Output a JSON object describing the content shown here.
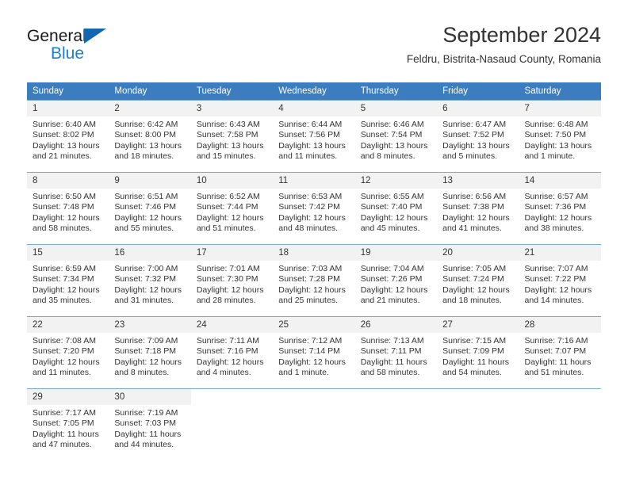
{
  "brand": {
    "word_one": "General",
    "word_two": "Blue",
    "triangle_color": "#1566b0",
    "blue_text_color": "#1a7fd4"
  },
  "header": {
    "month_title": "September 2024",
    "location": "Feldru, Bistrita-Nasaud County, Romania",
    "header_bg_color": "#3b7dbf",
    "header_text_color": "#ffffff",
    "daynum_bg_color": "#f2f2f2",
    "row_border_color": "#7aa9d4"
  },
  "calendar": {
    "weekday_headers": [
      "Sunday",
      "Monday",
      "Tuesday",
      "Wednesday",
      "Thursday",
      "Friday",
      "Saturday"
    ],
    "weeks": [
      [
        {
          "day": "1",
          "sunrise": "Sunrise: 6:40 AM",
          "sunset": "Sunset: 8:02 PM",
          "daylight": "Daylight: 13 hours and 21 minutes."
        },
        {
          "day": "2",
          "sunrise": "Sunrise: 6:42 AM",
          "sunset": "Sunset: 8:00 PM",
          "daylight": "Daylight: 13 hours and 18 minutes."
        },
        {
          "day": "3",
          "sunrise": "Sunrise: 6:43 AM",
          "sunset": "Sunset: 7:58 PM",
          "daylight": "Daylight: 13 hours and 15 minutes."
        },
        {
          "day": "4",
          "sunrise": "Sunrise: 6:44 AM",
          "sunset": "Sunset: 7:56 PM",
          "daylight": "Daylight: 13 hours and 11 minutes."
        },
        {
          "day": "5",
          "sunrise": "Sunrise: 6:46 AM",
          "sunset": "Sunset: 7:54 PM",
          "daylight": "Daylight: 13 hours and 8 minutes."
        },
        {
          "day": "6",
          "sunrise": "Sunrise: 6:47 AM",
          "sunset": "Sunset: 7:52 PM",
          "daylight": "Daylight: 13 hours and 5 minutes."
        },
        {
          "day": "7",
          "sunrise": "Sunrise: 6:48 AM",
          "sunset": "Sunset: 7:50 PM",
          "daylight": "Daylight: 13 hours and 1 minute."
        }
      ],
      [
        {
          "day": "8",
          "sunrise": "Sunrise: 6:50 AM",
          "sunset": "Sunset: 7:48 PM",
          "daylight": "Daylight: 12 hours and 58 minutes."
        },
        {
          "day": "9",
          "sunrise": "Sunrise: 6:51 AM",
          "sunset": "Sunset: 7:46 PM",
          "daylight": "Daylight: 12 hours and 55 minutes."
        },
        {
          "day": "10",
          "sunrise": "Sunrise: 6:52 AM",
          "sunset": "Sunset: 7:44 PM",
          "daylight": "Daylight: 12 hours and 51 minutes."
        },
        {
          "day": "11",
          "sunrise": "Sunrise: 6:53 AM",
          "sunset": "Sunset: 7:42 PM",
          "daylight": "Daylight: 12 hours and 48 minutes."
        },
        {
          "day": "12",
          "sunrise": "Sunrise: 6:55 AM",
          "sunset": "Sunset: 7:40 PM",
          "daylight": "Daylight: 12 hours and 45 minutes."
        },
        {
          "day": "13",
          "sunrise": "Sunrise: 6:56 AM",
          "sunset": "Sunset: 7:38 PM",
          "daylight": "Daylight: 12 hours and 41 minutes."
        },
        {
          "day": "14",
          "sunrise": "Sunrise: 6:57 AM",
          "sunset": "Sunset: 7:36 PM",
          "daylight": "Daylight: 12 hours and 38 minutes."
        }
      ],
      [
        {
          "day": "15",
          "sunrise": "Sunrise: 6:59 AM",
          "sunset": "Sunset: 7:34 PM",
          "daylight": "Daylight: 12 hours and 35 minutes."
        },
        {
          "day": "16",
          "sunrise": "Sunrise: 7:00 AM",
          "sunset": "Sunset: 7:32 PM",
          "daylight": "Daylight: 12 hours and 31 minutes."
        },
        {
          "day": "17",
          "sunrise": "Sunrise: 7:01 AM",
          "sunset": "Sunset: 7:30 PM",
          "daylight": "Daylight: 12 hours and 28 minutes."
        },
        {
          "day": "18",
          "sunrise": "Sunrise: 7:03 AM",
          "sunset": "Sunset: 7:28 PM",
          "daylight": "Daylight: 12 hours and 25 minutes."
        },
        {
          "day": "19",
          "sunrise": "Sunrise: 7:04 AM",
          "sunset": "Sunset: 7:26 PM",
          "daylight": "Daylight: 12 hours and 21 minutes."
        },
        {
          "day": "20",
          "sunrise": "Sunrise: 7:05 AM",
          "sunset": "Sunset: 7:24 PM",
          "daylight": "Daylight: 12 hours and 18 minutes."
        },
        {
          "day": "21",
          "sunrise": "Sunrise: 7:07 AM",
          "sunset": "Sunset: 7:22 PM",
          "daylight": "Daylight: 12 hours and 14 minutes."
        }
      ],
      [
        {
          "day": "22",
          "sunrise": "Sunrise: 7:08 AM",
          "sunset": "Sunset: 7:20 PM",
          "daylight": "Daylight: 12 hours and 11 minutes."
        },
        {
          "day": "23",
          "sunrise": "Sunrise: 7:09 AM",
          "sunset": "Sunset: 7:18 PM",
          "daylight": "Daylight: 12 hours and 8 minutes."
        },
        {
          "day": "24",
          "sunrise": "Sunrise: 7:11 AM",
          "sunset": "Sunset: 7:16 PM",
          "daylight": "Daylight: 12 hours and 4 minutes."
        },
        {
          "day": "25",
          "sunrise": "Sunrise: 7:12 AM",
          "sunset": "Sunset: 7:14 PM",
          "daylight": "Daylight: 12 hours and 1 minute."
        },
        {
          "day": "26",
          "sunrise": "Sunrise: 7:13 AM",
          "sunset": "Sunset: 7:11 PM",
          "daylight": "Daylight: 11 hours and 58 minutes."
        },
        {
          "day": "27",
          "sunrise": "Sunrise: 7:15 AM",
          "sunset": "Sunset: 7:09 PM",
          "daylight": "Daylight: 11 hours and 54 minutes."
        },
        {
          "day": "28",
          "sunrise": "Sunrise: 7:16 AM",
          "sunset": "Sunset: 7:07 PM",
          "daylight": "Daylight: 11 hours and 51 minutes."
        }
      ],
      [
        {
          "day": "29",
          "sunrise": "Sunrise: 7:17 AM",
          "sunset": "Sunset: 7:05 PM",
          "daylight": "Daylight: 11 hours and 47 minutes."
        },
        {
          "day": "30",
          "sunrise": "Sunrise: 7:19 AM",
          "sunset": "Sunset: 7:03 PM",
          "daylight": "Daylight: 11 hours and 44 minutes."
        },
        {
          "day": "",
          "sunrise": "",
          "sunset": "",
          "daylight": ""
        },
        {
          "day": "",
          "sunrise": "",
          "sunset": "",
          "daylight": ""
        },
        {
          "day": "",
          "sunrise": "",
          "sunset": "",
          "daylight": ""
        },
        {
          "day": "",
          "sunrise": "",
          "sunset": "",
          "daylight": ""
        },
        {
          "day": "",
          "sunrise": "",
          "sunset": "",
          "daylight": ""
        }
      ]
    ]
  }
}
